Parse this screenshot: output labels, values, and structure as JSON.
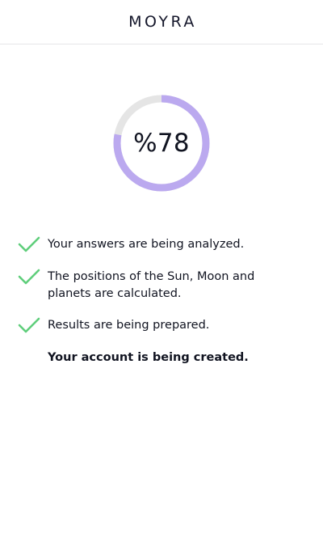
{
  "header": {
    "logo": "MOYRA"
  },
  "progress": {
    "label": "%78",
    "value": 78
  },
  "colors": {
    "ring_fill": "#bba9ef",
    "ring_track": "#e5e5e5",
    "check": "#5fce7b"
  },
  "steps": [
    {
      "text": "Your answers are being analyzed.",
      "done": true,
      "icon": "check-icon"
    },
    {
      "text": "The positions of the Sun, Moon and planets are calculated.",
      "done": true,
      "icon": "check-icon"
    },
    {
      "text": "Results are being prepared.",
      "done": true,
      "icon": "check-icon"
    },
    {
      "text": "Your account is being created.",
      "done": false,
      "active": true
    }
  ]
}
